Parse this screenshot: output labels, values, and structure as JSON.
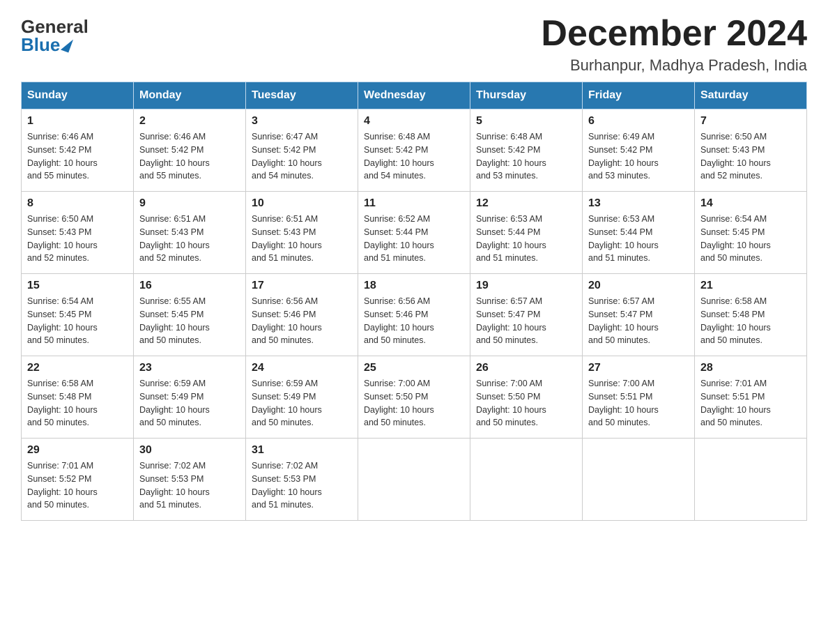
{
  "header": {
    "logo_general": "General",
    "logo_blue": "Blue",
    "month_title": "December 2024",
    "subtitle": "Burhanpur, Madhya Pradesh, India"
  },
  "days_of_week": [
    "Sunday",
    "Monday",
    "Tuesday",
    "Wednesday",
    "Thursday",
    "Friday",
    "Saturday"
  ],
  "weeks": [
    [
      {
        "day": "1",
        "sunrise": "6:46 AM",
        "sunset": "5:42 PM",
        "daylight": "10 hours and 55 minutes."
      },
      {
        "day": "2",
        "sunrise": "6:46 AM",
        "sunset": "5:42 PM",
        "daylight": "10 hours and 55 minutes."
      },
      {
        "day": "3",
        "sunrise": "6:47 AM",
        "sunset": "5:42 PM",
        "daylight": "10 hours and 54 minutes."
      },
      {
        "day": "4",
        "sunrise": "6:48 AM",
        "sunset": "5:42 PM",
        "daylight": "10 hours and 54 minutes."
      },
      {
        "day": "5",
        "sunrise": "6:48 AM",
        "sunset": "5:42 PM",
        "daylight": "10 hours and 53 minutes."
      },
      {
        "day": "6",
        "sunrise": "6:49 AM",
        "sunset": "5:42 PM",
        "daylight": "10 hours and 53 minutes."
      },
      {
        "day": "7",
        "sunrise": "6:50 AM",
        "sunset": "5:43 PM",
        "daylight": "10 hours and 52 minutes."
      }
    ],
    [
      {
        "day": "8",
        "sunrise": "6:50 AM",
        "sunset": "5:43 PM",
        "daylight": "10 hours and 52 minutes."
      },
      {
        "day": "9",
        "sunrise": "6:51 AM",
        "sunset": "5:43 PM",
        "daylight": "10 hours and 52 minutes."
      },
      {
        "day": "10",
        "sunrise": "6:51 AM",
        "sunset": "5:43 PM",
        "daylight": "10 hours and 51 minutes."
      },
      {
        "day": "11",
        "sunrise": "6:52 AM",
        "sunset": "5:44 PM",
        "daylight": "10 hours and 51 minutes."
      },
      {
        "day": "12",
        "sunrise": "6:53 AM",
        "sunset": "5:44 PM",
        "daylight": "10 hours and 51 minutes."
      },
      {
        "day": "13",
        "sunrise": "6:53 AM",
        "sunset": "5:44 PM",
        "daylight": "10 hours and 51 minutes."
      },
      {
        "day": "14",
        "sunrise": "6:54 AM",
        "sunset": "5:45 PM",
        "daylight": "10 hours and 50 minutes."
      }
    ],
    [
      {
        "day": "15",
        "sunrise": "6:54 AM",
        "sunset": "5:45 PM",
        "daylight": "10 hours and 50 minutes."
      },
      {
        "day": "16",
        "sunrise": "6:55 AM",
        "sunset": "5:45 PM",
        "daylight": "10 hours and 50 minutes."
      },
      {
        "day": "17",
        "sunrise": "6:56 AM",
        "sunset": "5:46 PM",
        "daylight": "10 hours and 50 minutes."
      },
      {
        "day": "18",
        "sunrise": "6:56 AM",
        "sunset": "5:46 PM",
        "daylight": "10 hours and 50 minutes."
      },
      {
        "day": "19",
        "sunrise": "6:57 AM",
        "sunset": "5:47 PM",
        "daylight": "10 hours and 50 minutes."
      },
      {
        "day": "20",
        "sunrise": "6:57 AM",
        "sunset": "5:47 PM",
        "daylight": "10 hours and 50 minutes."
      },
      {
        "day": "21",
        "sunrise": "6:58 AM",
        "sunset": "5:48 PM",
        "daylight": "10 hours and 50 minutes."
      }
    ],
    [
      {
        "day": "22",
        "sunrise": "6:58 AM",
        "sunset": "5:48 PM",
        "daylight": "10 hours and 50 minutes."
      },
      {
        "day": "23",
        "sunrise": "6:59 AM",
        "sunset": "5:49 PM",
        "daylight": "10 hours and 50 minutes."
      },
      {
        "day": "24",
        "sunrise": "6:59 AM",
        "sunset": "5:49 PM",
        "daylight": "10 hours and 50 minutes."
      },
      {
        "day": "25",
        "sunrise": "7:00 AM",
        "sunset": "5:50 PM",
        "daylight": "10 hours and 50 minutes."
      },
      {
        "day": "26",
        "sunrise": "7:00 AM",
        "sunset": "5:50 PM",
        "daylight": "10 hours and 50 minutes."
      },
      {
        "day": "27",
        "sunrise": "7:00 AM",
        "sunset": "5:51 PM",
        "daylight": "10 hours and 50 minutes."
      },
      {
        "day": "28",
        "sunrise": "7:01 AM",
        "sunset": "5:51 PM",
        "daylight": "10 hours and 50 minutes."
      }
    ],
    [
      {
        "day": "29",
        "sunrise": "7:01 AM",
        "sunset": "5:52 PM",
        "daylight": "10 hours and 50 minutes."
      },
      {
        "day": "30",
        "sunrise": "7:02 AM",
        "sunset": "5:53 PM",
        "daylight": "10 hours and 51 minutes."
      },
      {
        "day": "31",
        "sunrise": "7:02 AM",
        "sunset": "5:53 PM",
        "daylight": "10 hours and 51 minutes."
      },
      null,
      null,
      null,
      null
    ]
  ],
  "labels": {
    "sunrise": "Sunrise:",
    "sunset": "Sunset:",
    "daylight": "Daylight:"
  }
}
